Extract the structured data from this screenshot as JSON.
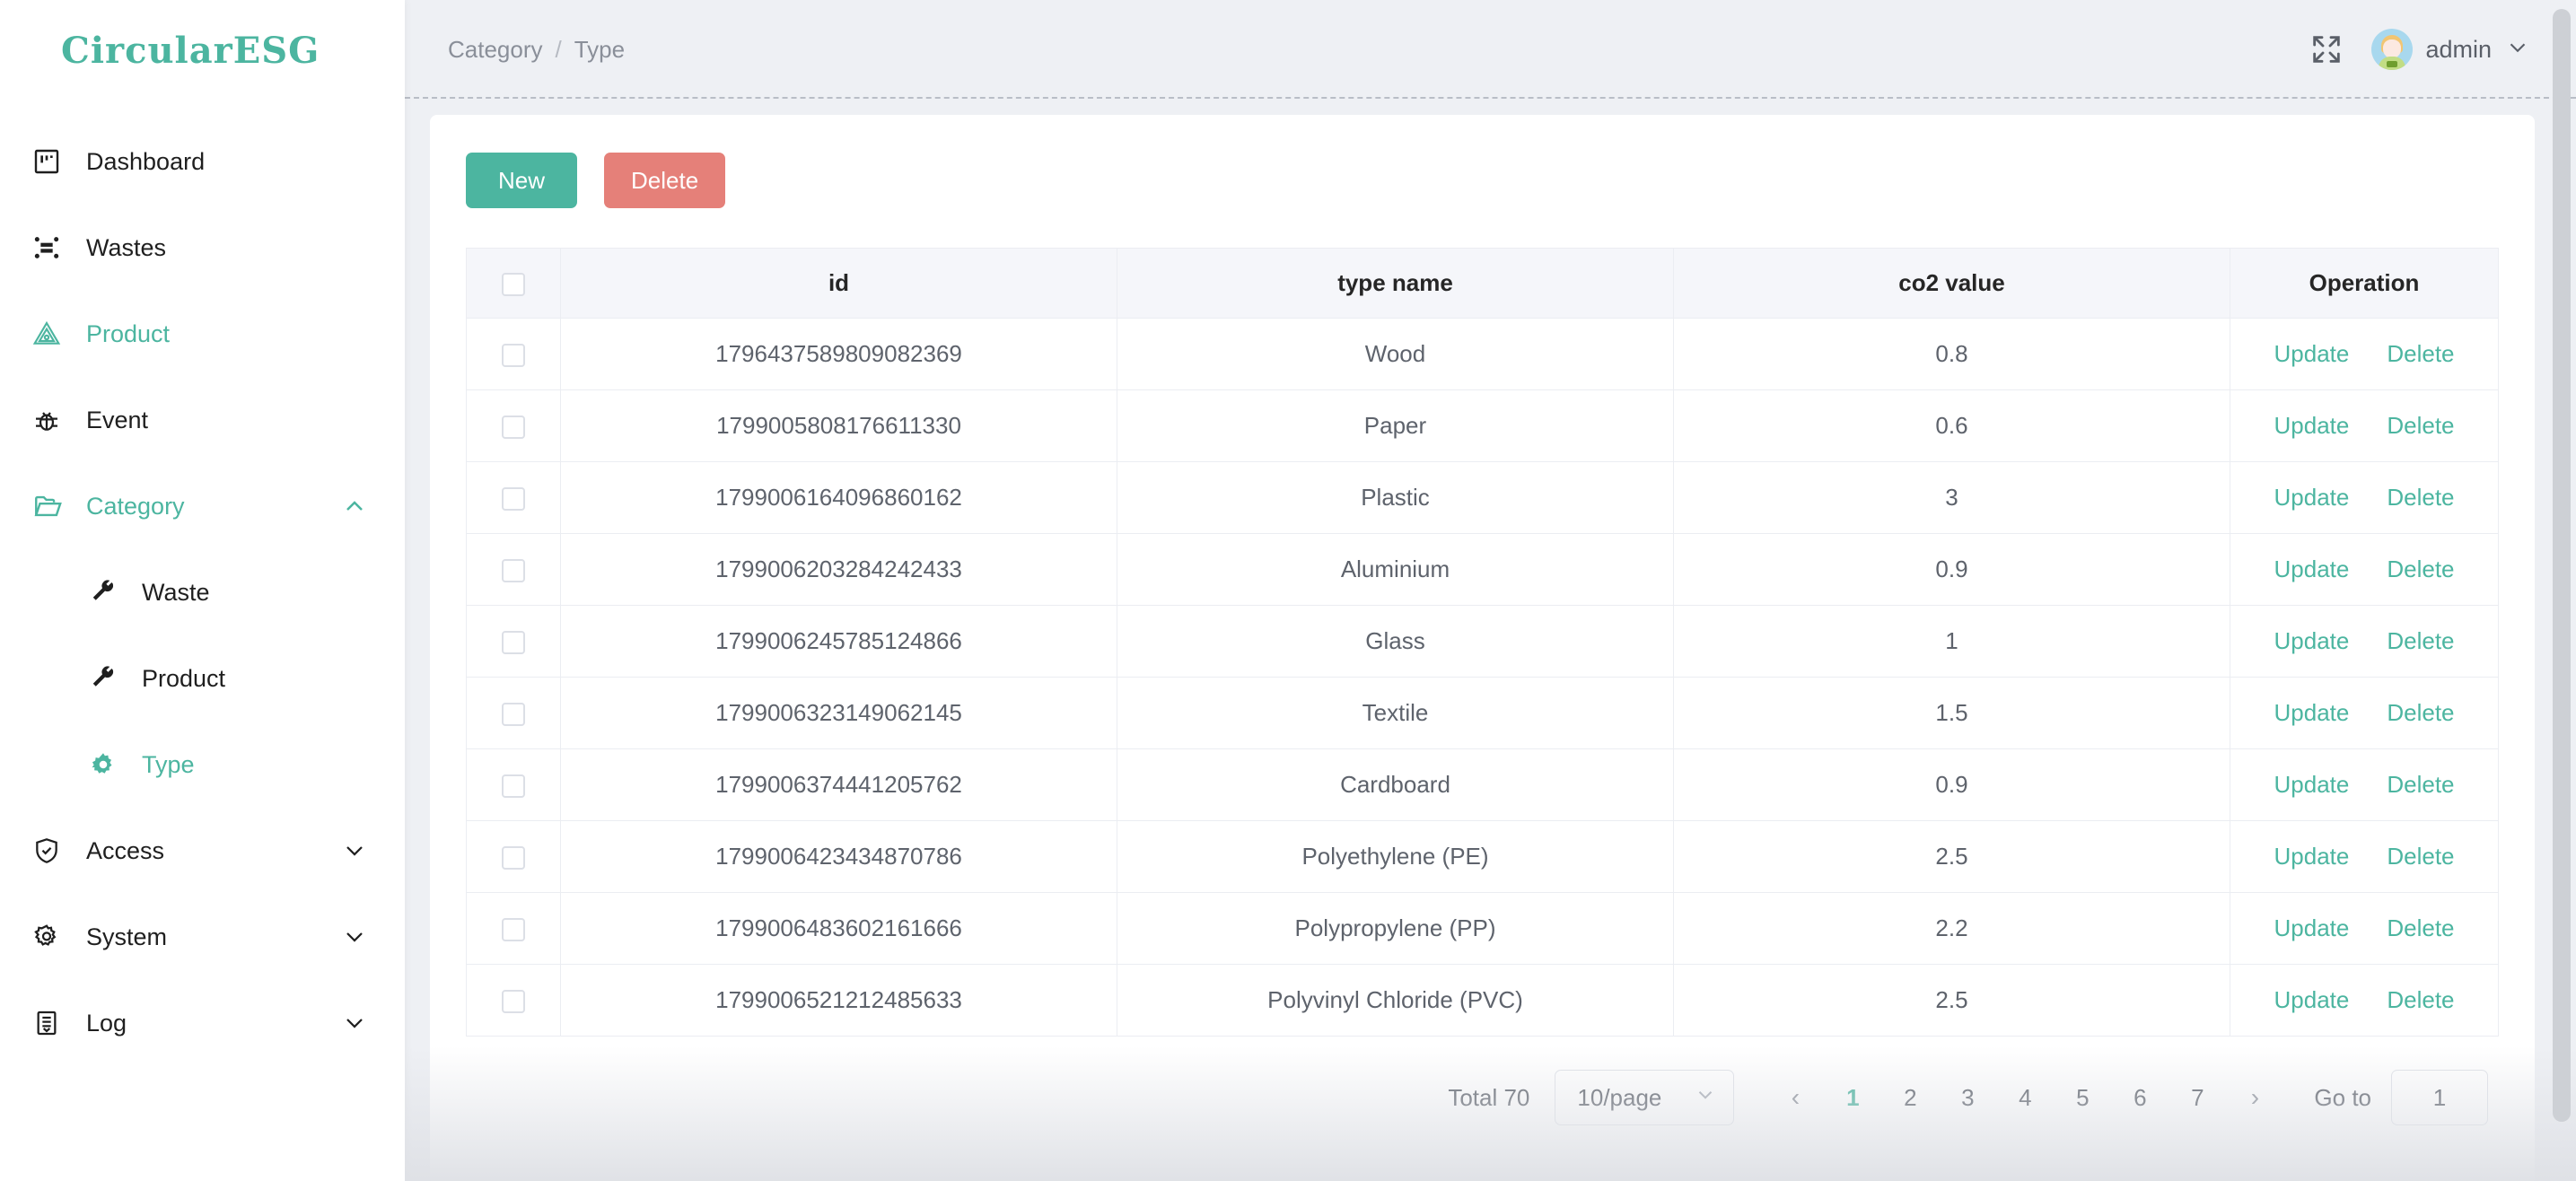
{
  "brand": {
    "name": "CircularESG"
  },
  "sidebar": {
    "items": [
      {
        "label": "Dashboard",
        "icon": "dashboard-icon",
        "accent": false,
        "sub": false,
        "caret": "none"
      },
      {
        "label": "Wastes",
        "icon": "wastes-icon",
        "accent": false,
        "sub": false,
        "caret": "none"
      },
      {
        "label": "Product",
        "icon": "product-icon",
        "accent": true,
        "sub": false,
        "caret": "none"
      },
      {
        "label": "Event",
        "icon": "bug-icon",
        "accent": false,
        "sub": false,
        "caret": "none"
      },
      {
        "label": "Category",
        "icon": "folder-icon",
        "accent": true,
        "sub": false,
        "caret": "up"
      },
      {
        "label": "Waste",
        "icon": "wrench-icon",
        "accent": false,
        "sub": true,
        "caret": "none"
      },
      {
        "label": "Product",
        "icon": "wrench-icon",
        "accent": false,
        "sub": true,
        "caret": "none"
      },
      {
        "label": "Type",
        "icon": "gear-icon",
        "accent": true,
        "sub": true,
        "caret": "none"
      },
      {
        "label": "Access",
        "icon": "shield-icon",
        "accent": false,
        "sub": false,
        "caret": "down"
      },
      {
        "label": "System",
        "icon": "gear-icon",
        "accent": false,
        "sub": false,
        "caret": "down"
      },
      {
        "label": "Log",
        "icon": "log-icon",
        "accent": false,
        "sub": false,
        "caret": "down"
      }
    ]
  },
  "topbar": {
    "breadcrumb": [
      "Category",
      "Type"
    ],
    "separator": "/",
    "fullscreen_icon": "fullscreen-icon",
    "user": {
      "name": "admin",
      "caret_icon": "chevron-down-icon",
      "avatar_icon": "avatar"
    }
  },
  "toolbar": {
    "new_label": "New",
    "delete_label": "Delete"
  },
  "table": {
    "columns": [
      "",
      "id",
      "type name",
      "co2 value",
      "Operation"
    ],
    "operation_labels": {
      "update": "Update",
      "delete": "Delete"
    },
    "rows": [
      {
        "id": "1796437589809082369",
        "type_name": "Wood",
        "co2": "0.8"
      },
      {
        "id": "1799005808176611330",
        "type_name": "Paper",
        "co2": "0.6"
      },
      {
        "id": "1799006164096860162",
        "type_name": "Plastic",
        "co2": "3"
      },
      {
        "id": "1799006203284242433",
        "type_name": "Aluminium",
        "co2": "0.9"
      },
      {
        "id": "1799006245785124866",
        "type_name": "Glass",
        "co2": "1"
      },
      {
        "id": "1799006323149062145",
        "type_name": "Textile",
        "co2": "1.5"
      },
      {
        "id": "1799006374441205762",
        "type_name": "Cardboard",
        "co2": "0.9"
      },
      {
        "id": "1799006423434870786",
        "type_name": "Polyethylene (PE)",
        "co2": "2.5"
      },
      {
        "id": "1799006483602161666",
        "type_name": "Polypropylene (PP)",
        "co2": "2.2"
      },
      {
        "id": "1799006521212485633",
        "type_name": "Polyvinyl Chloride (PVC)",
        "co2": "2.5"
      }
    ]
  },
  "pagination": {
    "total_label": "Total 70",
    "page_size": "10/page",
    "prev_icon": "‹",
    "next_icon": "›",
    "pages": [
      "1",
      "2",
      "3",
      "4",
      "5",
      "6",
      "7"
    ],
    "active_page": "1",
    "goto_label": "Go to",
    "goto_value": "1"
  },
  "colors": {
    "accent": "#4cb5a0",
    "danger": "#e58079",
    "text": "#5e636c",
    "bg": "#eef0f4"
  }
}
